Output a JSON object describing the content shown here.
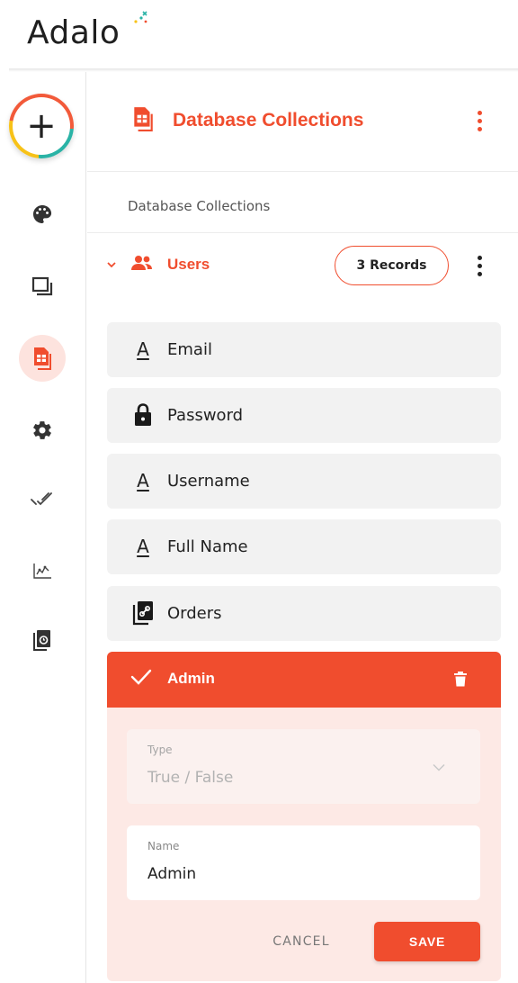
{
  "app": {
    "logo_text": "Adalo",
    "brand_color": "#f04d2e"
  },
  "sidebar": {
    "add_label": "+",
    "items": [
      {
        "icon": "palette-icon",
        "active": false
      },
      {
        "icon": "screens-icon",
        "active": false
      },
      {
        "icon": "database-icon",
        "active": true
      },
      {
        "icon": "gear-icon",
        "active": false
      },
      {
        "icon": "publish-check-icon",
        "active": false
      },
      {
        "icon": "analytics-icon",
        "active": false
      },
      {
        "icon": "version-history-icon",
        "active": false
      }
    ]
  },
  "header": {
    "title": "Database Collections",
    "icon": "database-icon"
  },
  "section": {
    "label": "Database Collections"
  },
  "collection": {
    "name": "Users",
    "records_label": "3 Records",
    "properties": [
      {
        "label": "Email",
        "icon": "text-icon"
      },
      {
        "label": "Password",
        "icon": "lock-icon"
      },
      {
        "label": "Username",
        "icon": "text-icon"
      },
      {
        "label": "Full Name",
        "icon": "text-icon"
      },
      {
        "label": "Orders",
        "icon": "relationship-icon"
      }
    ]
  },
  "edit": {
    "title": "Admin",
    "type_caption": "Type",
    "type_value": "True / False",
    "name_caption": "Name",
    "name_value": "Admin",
    "cancel_label": "CANCEL",
    "save_label": "SAVE"
  }
}
